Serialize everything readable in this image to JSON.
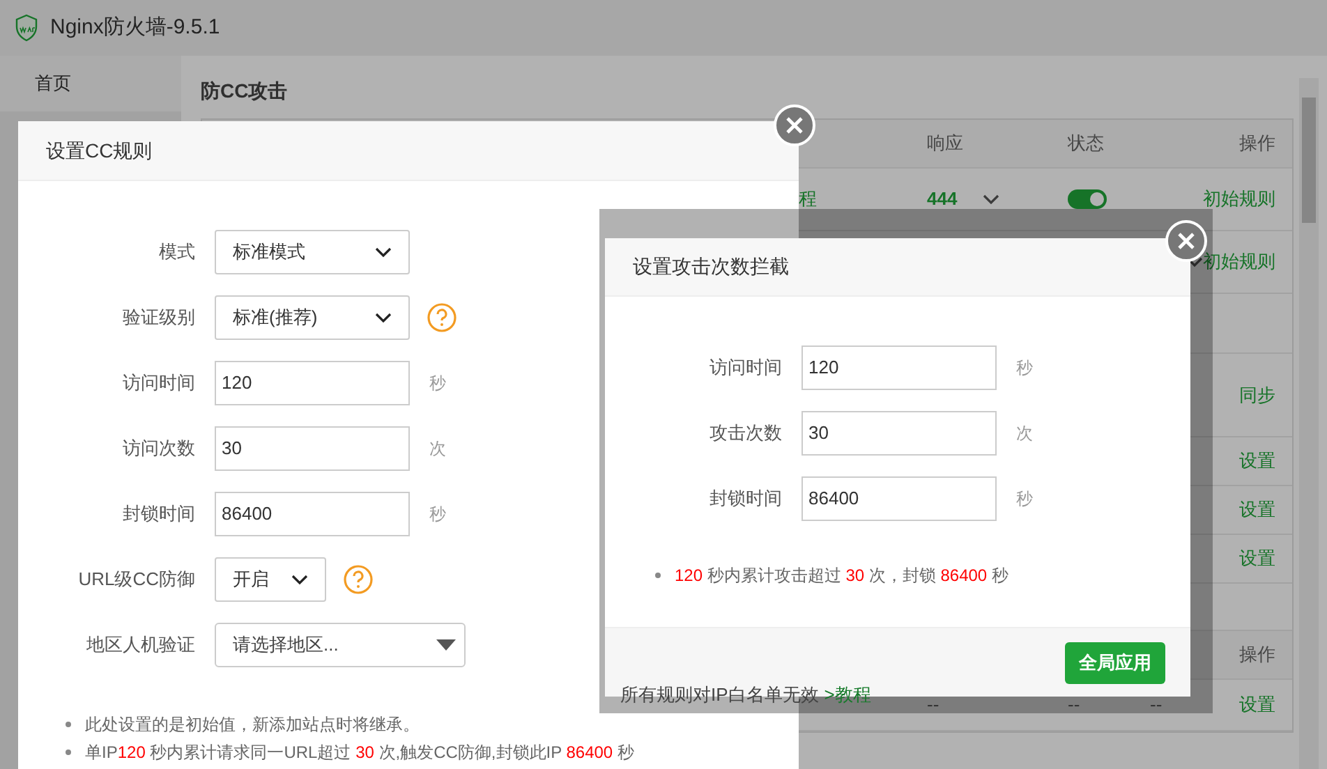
{
  "window": {
    "title": "Nginx防火墙-9.5.1"
  },
  "sidebar": {
    "items": [
      {
        "label": "首页",
        "selected": true
      }
    ]
  },
  "page": {
    "title": "防CC攻击"
  },
  "table": {
    "rows": [
      {
        "kind": "header",
        "response": "响应",
        "status": "状态",
        "action": "操作"
      },
      {
        "kind": "row",
        "column_1": "程",
        "response": "444",
        "response_dropdown": true,
        "status_on": true,
        "action": "初始规则"
      },
      {
        "kind": "row",
        "column_4_dropdown": true,
        "action": "初始规则"
      },
      {
        "kind": "row"
      },
      {
        "kind": "row",
        "action": "同步"
      },
      {
        "kind": "row",
        "action": "设置"
      },
      {
        "kind": "row",
        "action": "设置"
      },
      {
        "kind": "row",
        "action": "设置"
      },
      {
        "kind": "row"
      },
      {
        "kind": "header",
        "action": "操作"
      },
      {
        "kind": "row",
        "column_1": "所有规则对IP白名单无效",
        "column_1_link": ">教程",
        "response": "--",
        "status": "--",
        "column_4": "--",
        "action": "设置"
      }
    ]
  },
  "cc_dialog": {
    "title": "设置CC规则",
    "fields": [
      {
        "kind": "select",
        "label": "模式",
        "value": "标准模式",
        "help": false
      },
      {
        "kind": "select",
        "label": "验证级别",
        "value": "标准(推荐)",
        "help": true
      },
      {
        "kind": "input",
        "label": "访问时间",
        "value": "120",
        "unit": "秒"
      },
      {
        "kind": "input",
        "label": "访问次数",
        "value": "30",
        "unit": "次"
      },
      {
        "kind": "input",
        "label": "封锁时间",
        "value": "86400",
        "unit": "秒"
      },
      {
        "kind": "small_select",
        "label": "URL级CC防御",
        "value": "开启",
        "help": true
      },
      {
        "kind": "combo",
        "label": "地区人机验证",
        "placeholder": "请选择地区..."
      }
    ],
    "notes": [
      [
        {
          "text": "此处设置的是初始值，新添加站点时将继承。",
          "highlight": false
        }
      ],
      [
        {
          "text": "单IP",
          "highlight": false
        },
        {
          "text": "120",
          "highlight": true
        },
        {
          "text": " 秒内累计请求同一URL超过 ",
          "highlight": false
        },
        {
          "text": "30",
          "highlight": true
        },
        {
          "text": " 次,触发CC防御,封锁此IP ",
          "highlight": false
        },
        {
          "text": "86400",
          "highlight": true
        },
        {
          "text": " 秒",
          "highlight": false
        }
      ]
    ]
  },
  "attack_dialog": {
    "title": "设置攻击次数拦截",
    "fields": [
      {
        "kind": "input",
        "label": "访问时间",
        "value": "120",
        "unit": "秒"
      },
      {
        "kind": "input",
        "label": "攻击次数",
        "value": "30",
        "unit": "次"
      },
      {
        "kind": "input",
        "label": "封锁时间",
        "value": "86400",
        "unit": "秒"
      }
    ],
    "notes": [
      [
        {
          "text": "120",
          "highlight": true
        },
        {
          "text": " 秒内累计攻击超过 ",
          "highlight": false
        },
        {
          "text": "30",
          "highlight": true
        },
        {
          "text": " 次，封锁 ",
          "highlight": false
        },
        {
          "text": "86400",
          "highlight": true
        },
        {
          "text": " 秒",
          "highlight": false
        }
      ]
    ],
    "button": "全局应用"
  }
}
